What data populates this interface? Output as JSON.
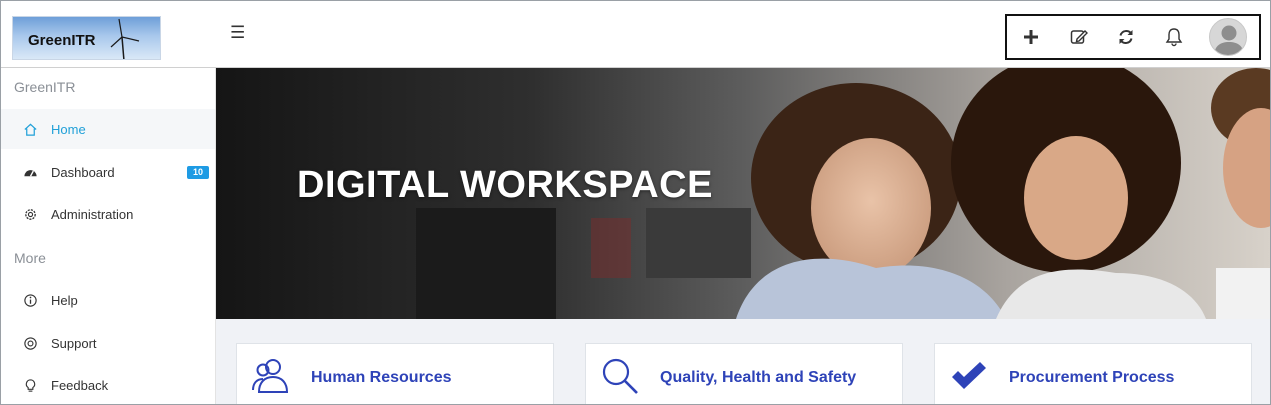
{
  "brand": {
    "logo_text": "GreenITR"
  },
  "header": {
    "menu_icon": "hamburger-icon",
    "toolbar": [
      {
        "name": "add",
        "icon": "plus-icon"
      },
      {
        "name": "edit",
        "icon": "edit-note-icon"
      },
      {
        "name": "refresh",
        "icon": "refresh-icon"
      },
      {
        "name": "notifications",
        "icon": "bell-icon"
      },
      {
        "name": "profile",
        "icon": "user-avatar"
      }
    ]
  },
  "sidebar": {
    "section_main": "GreenITR",
    "section_more": "More",
    "items": [
      {
        "label": "Home",
        "icon": "home-icon",
        "active": true
      },
      {
        "label": "Dashboard",
        "icon": "dashboard-gauge-icon",
        "badge": "10"
      },
      {
        "label": "Administration",
        "icon": "gear-icon"
      },
      {
        "label": "Help",
        "icon": "info-icon"
      },
      {
        "label": "Support",
        "icon": "lifebuoy-icon"
      },
      {
        "label": "Feedback",
        "icon": "lightbulb-icon"
      }
    ]
  },
  "hero": {
    "title": "DIGITAL WORKSPACE"
  },
  "cards": [
    {
      "title": "Human Resources",
      "icon": "users-icon"
    },
    {
      "title": "Quality, Health and Safety",
      "icon": "search-icon"
    },
    {
      "title": "Procurement Process",
      "icon": "checkmark-icon"
    }
  ],
  "colors": {
    "accent": "#20a0d8",
    "card_title": "#2e43b8",
    "badge": "#1e9be4",
    "content_bg": "#f0f2f6"
  }
}
